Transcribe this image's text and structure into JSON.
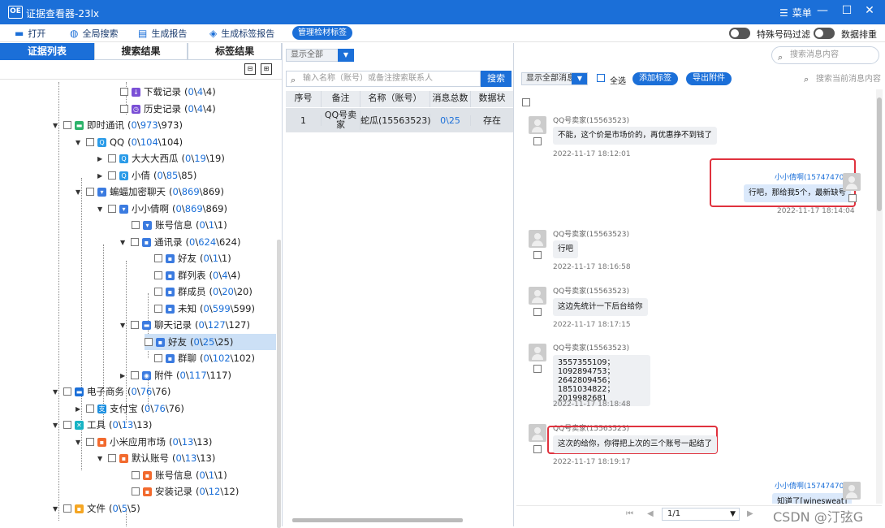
{
  "window": {
    "title": "证据查看器-23lx",
    "menu_label": "菜单",
    "app_icon_label": "OE"
  },
  "toolbar": {
    "open": "打开",
    "global_search": "全局搜索",
    "gen_report": "生成报告",
    "gen_tag_report": "生成标签报告",
    "manage_tags": "管理检材标签",
    "special_filter": "特殊号码过滤",
    "data_sort": "数据排重"
  },
  "left_tabs": [
    "证据列表",
    "搜索结果",
    "标签结果"
  ],
  "tree": [
    {
      "label": "下载记录",
      "a": "0",
      "b": "4",
      "c": "4"
    },
    {
      "label": "历史记录",
      "a": "0",
      "b": "4",
      "c": "4"
    },
    {
      "label": "即时通讯",
      "a": "0",
      "b": "973",
      "c": "973"
    },
    {
      "label": "QQ",
      "a": "0",
      "b": "104",
      "c": "104"
    },
    {
      "label": "大大大西瓜",
      "a": "0",
      "b": "19",
      "c": "19"
    },
    {
      "label": "小倩",
      "a": "0",
      "b": "85",
      "c": "85"
    },
    {
      "label": "蝙蝠加密聊天",
      "a": "0",
      "b": "869",
      "c": "869"
    },
    {
      "label": "小小倩啊",
      "a": "0",
      "b": "869",
      "c": "869"
    },
    {
      "label": "账号信息",
      "a": "0",
      "b": "1",
      "c": "1"
    },
    {
      "label": "通讯录",
      "a": "0",
      "b": "624",
      "c": "624"
    },
    {
      "label": "好友",
      "a": "0",
      "b": "1",
      "c": "1"
    },
    {
      "label": "群列表",
      "a": "0",
      "b": "4",
      "c": "4"
    },
    {
      "label": "群成员",
      "a": "0",
      "b": "20",
      "c": "20"
    },
    {
      "label": "未知",
      "a": "0",
      "b": "599",
      "c": "599"
    },
    {
      "label": "聊天记录",
      "a": "0",
      "b": "127",
      "c": "127"
    },
    {
      "label": "好友",
      "a": "0",
      "b": "25",
      "c": "25"
    },
    {
      "label": "群聊",
      "a": "0",
      "b": "102",
      "c": "102"
    },
    {
      "label": "附件",
      "a": "0",
      "b": "117",
      "c": "117"
    },
    {
      "label": "电子商务",
      "a": "0",
      "b": "76",
      "c": "76"
    },
    {
      "label": "支付宝",
      "a": "0",
      "b": "76",
      "c": "76"
    },
    {
      "label": "工具",
      "a": "0",
      "b": "13",
      "c": "13"
    },
    {
      "label": "小米应用市场",
      "a": "0",
      "b": "13",
      "c": "13"
    },
    {
      "label": "默认账号",
      "a": "0",
      "b": "13",
      "c": "13"
    },
    {
      "label": "账号信息",
      "a": "0",
      "b": "1",
      "c": "1"
    },
    {
      "label": "安装记录",
      "a": "0",
      "b": "12",
      "c": "12"
    },
    {
      "label": "文件",
      "a": "0",
      "b": "5",
      "c": "5"
    }
  ],
  "middle": {
    "show_all": "显示全部",
    "search_placeholder": "输入名称（账号）或备注搜索联系人",
    "search_btn": "搜索",
    "columns": [
      "序号",
      "备注",
      "名称（账号）",
      "消息总数",
      "数据状"
    ],
    "rows": [
      {
        "no": "1",
        "remark": "QQ号卖家",
        "name": "蛇瓜(15563523)",
        "count": "0\\25",
        "status": "存在"
      }
    ]
  },
  "right": {
    "search_placeholder": "搜索消息内容",
    "show_all_msgs": "显示全部消息",
    "select_all": "全选",
    "add_tag": "添加标签",
    "export_att": "导出附件",
    "search_current": "搜索当前消息内容",
    "messages": [
      {
        "sender": "QQ号卖家(15563523)",
        "text": "不能，这个价是市场价的，再优惠挣不到钱了",
        "time": "2022-11-17 18:12:01"
      },
      {
        "sender": "小小倩啊(15747470)",
        "text": "行吧，那给我5个，最新缺号",
        "time": "2022-11-17 18:14:04"
      },
      {
        "sender": "QQ号卖家(15563523)",
        "text": "行吧",
        "time": "2022-11-17 18:16:58"
      },
      {
        "sender": "QQ号卖家(15563523)",
        "text": "这边先统计一下后台给你",
        "time": "2022-11-17 18:17:15"
      },
      {
        "sender": "QQ号卖家(15563523)",
        "lines": [
          "3557355109；1092894753；",
          "2642809456；",
          "1851034822；",
          "2019982681"
        ],
        "time": "2022-11-17 18:18:48"
      },
      {
        "sender": "QQ号卖家(15563523)",
        "text": "这次的给你，你得把上次的三个账号一起结了",
        "time": "2022-11-17 18:19:17"
      },
      {
        "sender": "小小倩啊(15747470)",
        "text": "知道了[winesweat]"
      }
    ],
    "page": "1/1"
  },
  "watermark": "CSDN @汀弦G",
  "colors": {
    "accent": "#1b6fd8",
    "highlight": "#e0323e"
  }
}
